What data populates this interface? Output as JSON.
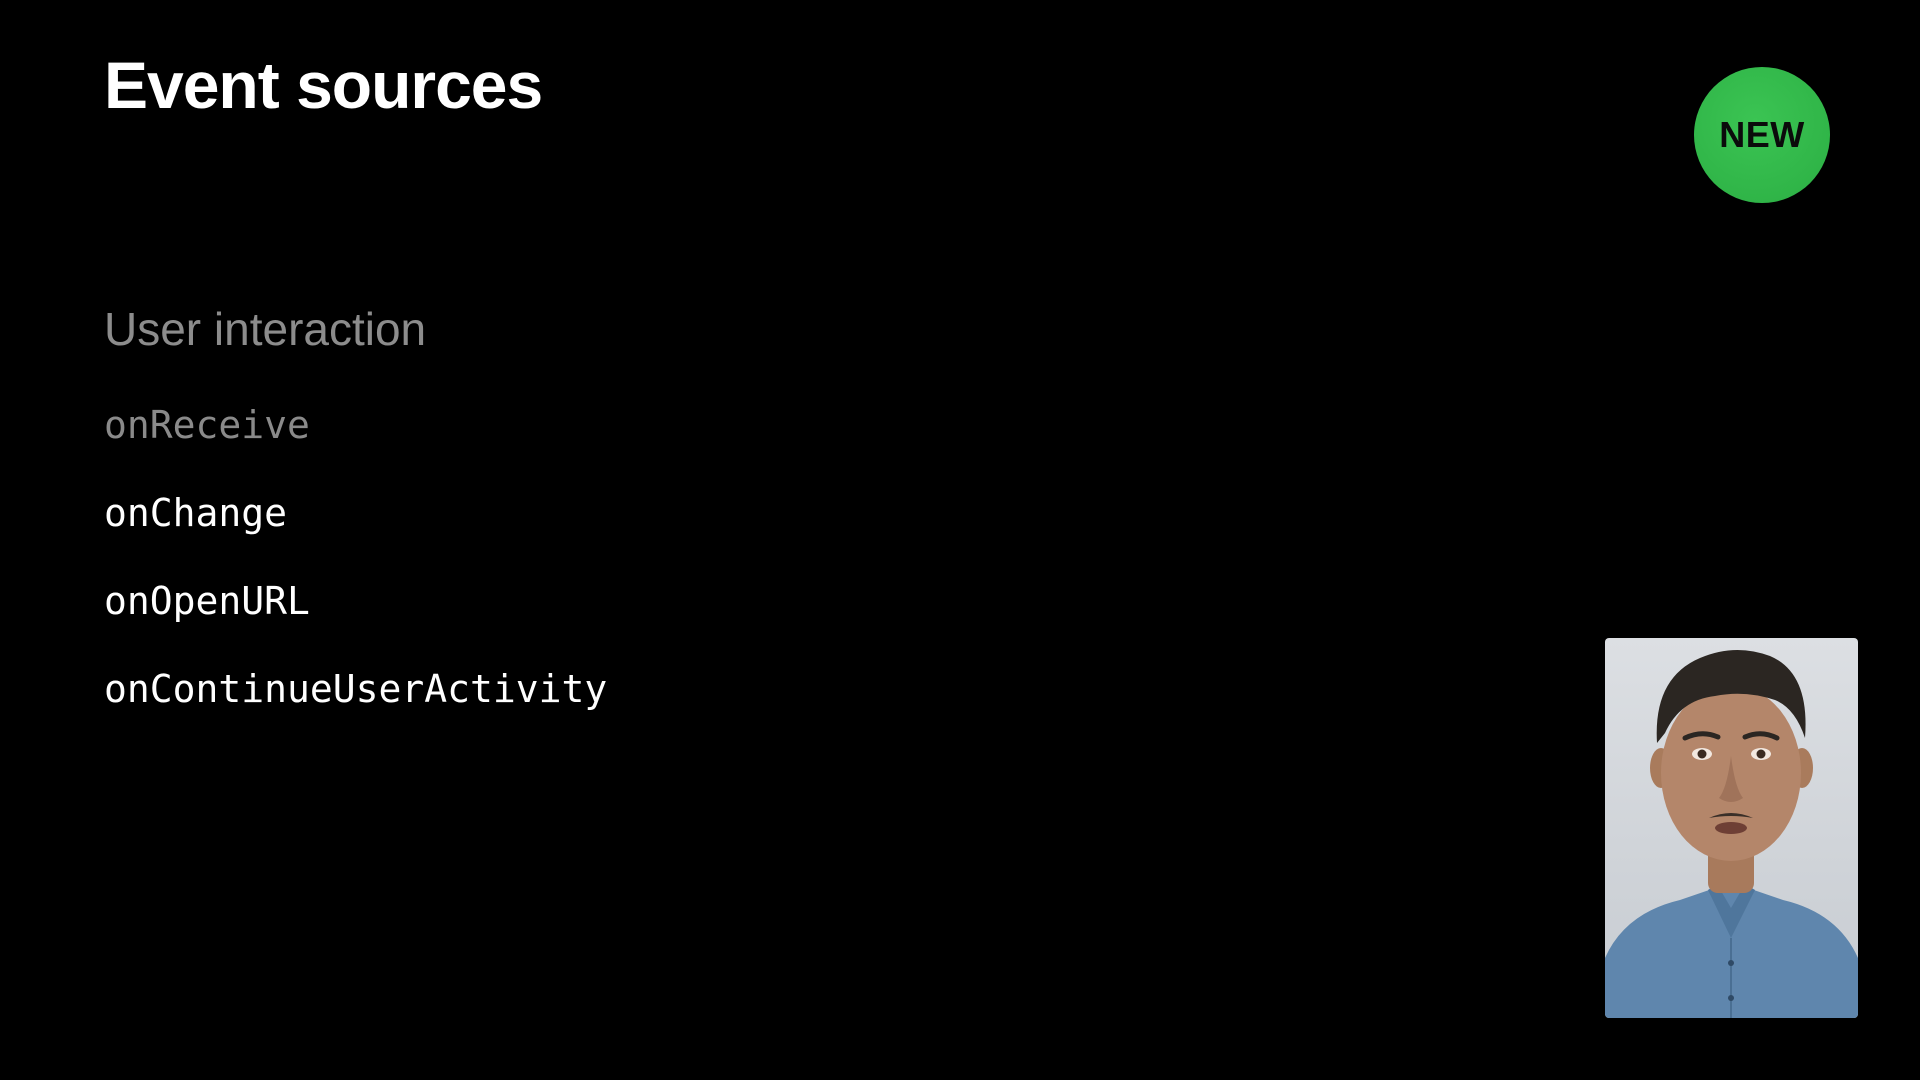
{
  "slide": {
    "title": "Event sources",
    "badge": "NEW",
    "section_heading": "User interaction",
    "items": [
      {
        "label": "onReceive",
        "state": "dimmed"
      },
      {
        "label": "onChange",
        "state": "active"
      },
      {
        "label": "onOpenURL",
        "state": "active"
      },
      {
        "label": "onContinueUserActivity",
        "state": "active"
      }
    ]
  },
  "presenter": {
    "icon": "presenter-video-icon"
  },
  "colors": {
    "background": "#000000",
    "title": "#ffffff",
    "badge": "#30b548",
    "heading": "#8c8c8c",
    "dimmed_item": "#8a8a8a",
    "active_item": "#ffffff"
  }
}
